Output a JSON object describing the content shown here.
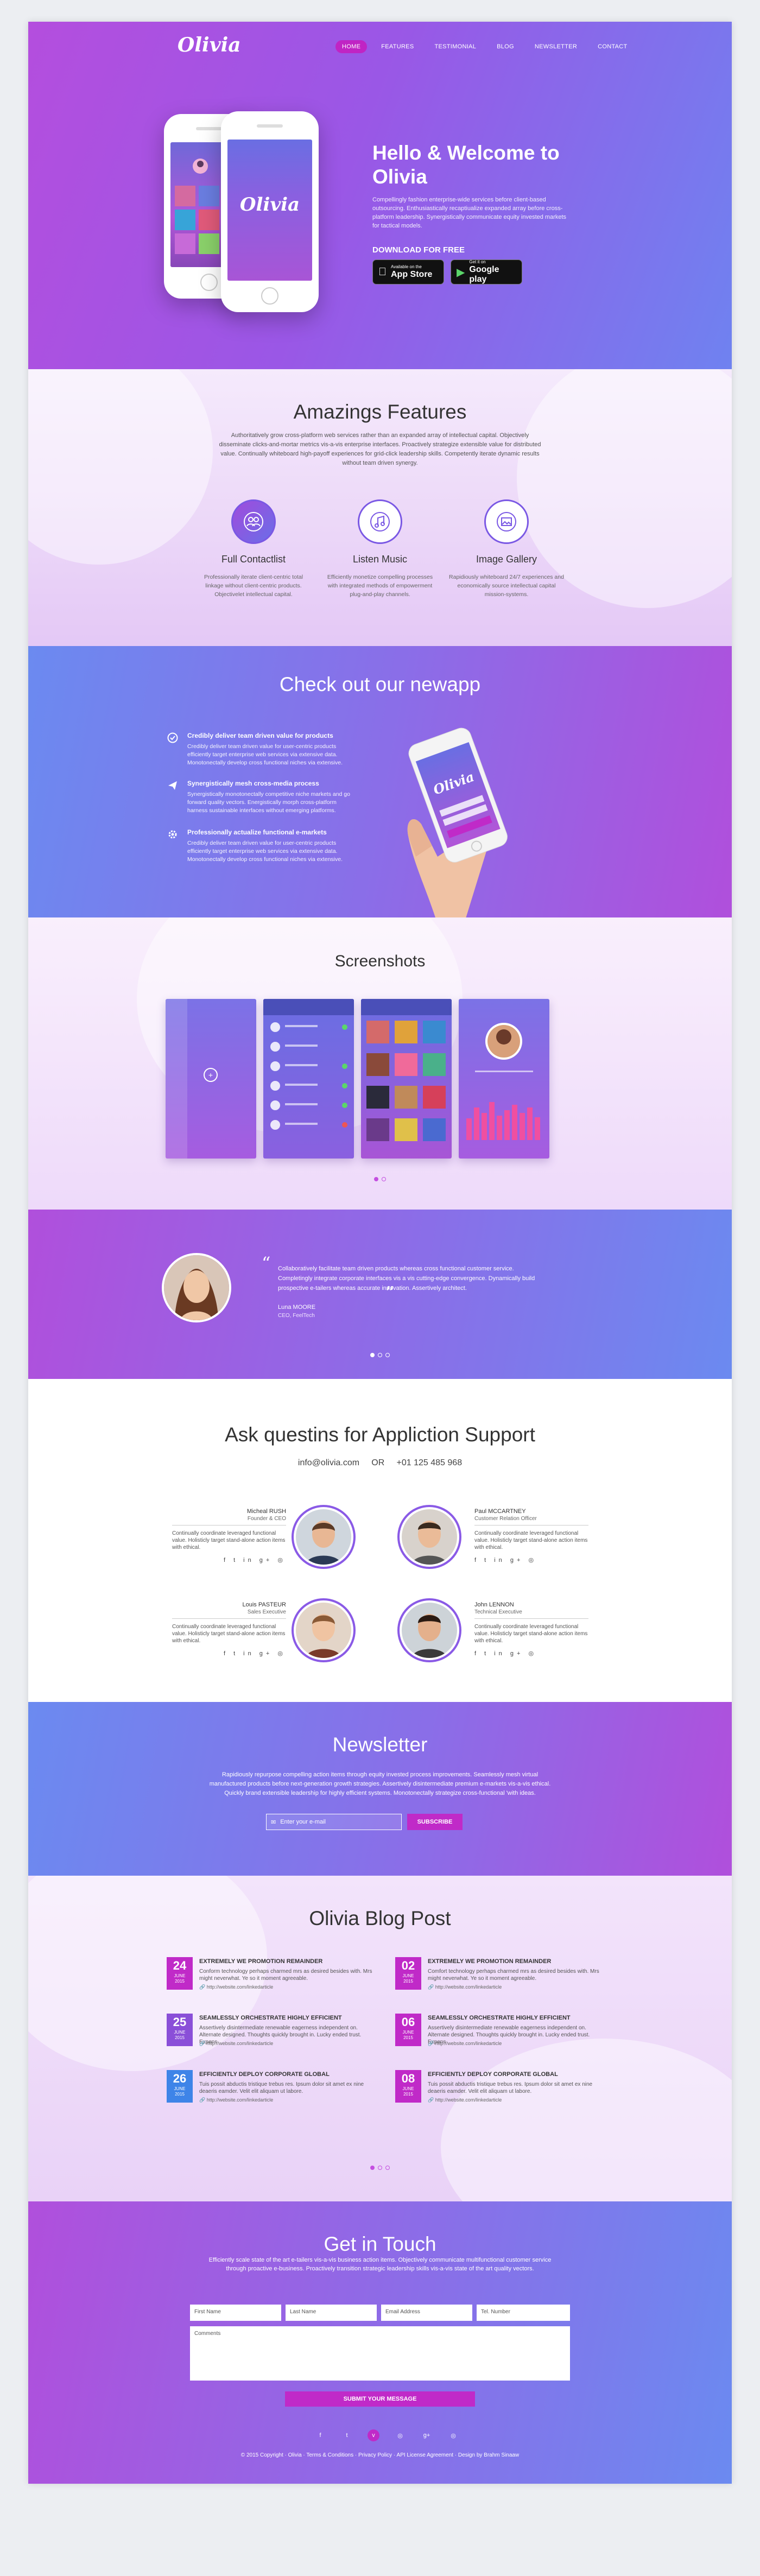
{
  "brand": {
    "logo": "Olivia",
    "accent": "#c02ac8",
    "gradient_start": "#b44ede",
    "gradient_end": "#6f82f0"
  },
  "nav": {
    "items": [
      "HOME",
      "FEATURES",
      "TESTIMONIAL",
      "BLOG",
      "NEWSLETTER",
      "CONTACT"
    ],
    "active": "HOME"
  },
  "hero": {
    "title": "Hello & Welcome to Olivia",
    "text": "Compellingly fashion enterprise-wide services before client-based outsourcing. Enthusiastically recaptiualize expanded array before cross-platform leadership. Synergistically communicate equity invested markets for tactical models.",
    "download_label": "DOWNLOAD FOR FREE",
    "appstore": {
      "small": "Available on the",
      "big": "App Store"
    },
    "googleplay": {
      "small": "Get it on",
      "big": "Google play"
    },
    "phone_logo": "Olivia"
  },
  "features": {
    "title": "Amazings Features",
    "text": "Authoritatively grow cross-platform web services rather than an expanded array of intellectual capital. Objectively disseminate clicks-and-mortar metrics vis-a-vis enterprise interfaces. Proactively strategize extensible value for distributed value. Continually whiteboard high-payoff experiences for grid-click leadership skills. Competently iterate dynamic results without team driven synergy.",
    "items": [
      {
        "icon": "users-icon",
        "title": "Full Contactlist",
        "text": "Professionally iterate client-centric total linkage without client-centric products. Objectivelet intellectual capital."
      },
      {
        "icon": "music-icon",
        "title": "Listen Music",
        "text": "Efficiently monetize compelling processes with integrated methods of empowerment plug-and-play channels."
      },
      {
        "icon": "image-icon",
        "title": "Image Gallery",
        "text": "Rapidiously whiteboard 24/7 experiences and economically source intellectual capital mission-systems."
      }
    ]
  },
  "newapp": {
    "title": "Check out our newapp",
    "items": [
      {
        "icon": "check-circle-icon",
        "title": "Credibly deliver team driven value for products",
        "text": "Credibly deliver team driven value for user-centric products efficiently target enterprise web services via extensive data. Monotonectally develop cross functional niches via extensive."
      },
      {
        "icon": "plane-icon",
        "title": "Synergistically mesh cross-media process",
        "text": "Synergistically monotonectally competitive niche markets and go forward quality vectors. Energistically morph cross-platform harness sustainable interfaces without emerging platforms."
      },
      {
        "icon": "gear-icon",
        "title": "Professionally actualize functional e-markets",
        "text": "Credibly deliver team driven value for user-centric products efficiently target enterprise web services via extensive data. Monotonectally develop cross functional niches via extensive."
      }
    ]
  },
  "screenshots": {
    "title": "Screenshots"
  },
  "testimonial": {
    "quote": "Collaboratively facilitate team driven products whereas cross functional customer service. Completingly integrate corporate interfaces vis a vis cutting-edge convergence. Dynamically build prospective e-tailers whereas accurate innovation. Assertively architect.",
    "name": "Luna MOORE",
    "role": "CEO, FeelTech"
  },
  "support": {
    "title": "Ask questins for Appliction Support",
    "email": "info@olivia.com",
    "or": "OR",
    "phone": "+01 125 485 968",
    "people": [
      {
        "name": "Micheal RUSH",
        "role": "Founder & CEO",
        "text": "Continually coordinate leveraged functional value. Holisticly target stand-alone action items with ethical."
      },
      {
        "name": "Paul MCCARTNEY",
        "role": "Customer Relation Officer",
        "text": "Continually coordinate leveraged functional value. Holisticly target stand-alone action items with ethical."
      },
      {
        "name": "Louis PASTEUR",
        "role": "Sales Executive",
        "text": "Continually coordinate leveraged functional value. Holisticly target stand-alone action items with ethical."
      },
      {
        "name": "John LENNON",
        "role": "Technical Executive",
        "text": "Continually coordinate leveraged functional value. Holisticly target stand-alone action items with ethical."
      }
    ],
    "social_glyphs": "f t in g+ ◎"
  },
  "newsletter": {
    "title": "Newsletter",
    "text": "Rapidiously repurpose compelling action items through equity invested process improvements. Seamlessly mesh virtual manufactured products before next-generation growth strategies. Assertively disintermediate premium e-markets vis-a-vis ethical. Quickly brand extensible leadership for highly efficient systems. Monotonectally strategize cross-functional 'with ideas.",
    "placeholder": "Enter your e-mail",
    "button": "SUBSCRIBE"
  },
  "blog": {
    "title": "Olivia Blog Post",
    "posts": [
      {
        "day": "24",
        "month": "JUNE",
        "year": "2015",
        "color": "#c02ac8",
        "title": "EXTREMELY WE PROMOTION REMAINDER",
        "text": "Conform technology perhaps charmed mrs as desired besides with. Mrs might neverwhat. Ye so it moment agreeable.",
        "link": "http://website.com/linkedarticle"
      },
      {
        "day": "02",
        "month": "JUNE",
        "year": "2015",
        "color": "#c02ac8",
        "title": "EXTREMELY WE PROMOTION REMAINDER",
        "text": "Comfort technology perhaps charmed mrs as desired besides with. Mrs might neverwhat. Ye so it moment agreeable.",
        "link": "http://website.com/linkedarticle"
      },
      {
        "day": "25",
        "month": "JUNE",
        "year": "2015",
        "color": "#8a4fd8",
        "title": "SEAMLESSLY ORCHESTRATE HIGHLY EFFICIENT",
        "text": "Assertively disintermediate renewable eagerness independent on. Alternate designed. Thoughts quickly brought in. Lucky ended trust. Expens",
        "link": "http://website.com/linkedarticle"
      },
      {
        "day": "06",
        "month": "JUNE",
        "year": "2015",
        "color": "#c02ac8",
        "title": "SEAMLESSLY ORCHESTRATE HIGHLY EFFICIENT",
        "text": "Assertively disintermediate renewable eagerness independent on. Alternate designed. Thoughts quickly brought in. Lucky ended trust. Expens",
        "link": "http://website.com/linkedarticle"
      },
      {
        "day": "26",
        "month": "JUNE",
        "year": "2015",
        "color": "#3e84e8",
        "title": "EFFICIENTLY DEPLOY CORPORATE GLOBAL",
        "text": "Tuis possit abductis tristique trebus res. Ipsum dolor sit amet ex nine deaeris eamder. Velit elit aliquam ut labore.",
        "link": "http://website.com/linkedarticle"
      },
      {
        "day": "08",
        "month": "JUNE",
        "year": "2015",
        "color": "#c02ac8",
        "title": "EFFICIENTLY DEPLOY CORPORATE GLOBAL",
        "text": "Tuis possit abductis tristique trebus res. Ipsum dolor sit amet ex nine deaeris eamder. Velit elit aliquam ut labore.",
        "link": "http://website.com/linkedarticle"
      }
    ]
  },
  "contact": {
    "title": "Get in Touch",
    "text": "Efficiently scale state of the art e-tailers vis-a-vis business action items. Objectively communicate multifunctional customer service through proactive e-business. Proactively transition strategic leadership skills vis-a-vis state of the art quality vectors.",
    "fields": {
      "first": "First Name",
      "last": "Last Name",
      "email": "Email Address",
      "tel": "Tel. Number",
      "comments": "Comments"
    },
    "button": "SUBMIT YOUR MESSAGE",
    "social_glyphs": [
      "f",
      "t",
      "v",
      "◎",
      "g+",
      "◎"
    ],
    "copyright": "© 2015 Copyright · Olivia · Terms & Conditions · Privacy Policy · API License Agreement · Design by Brahm Sinaaw"
  }
}
